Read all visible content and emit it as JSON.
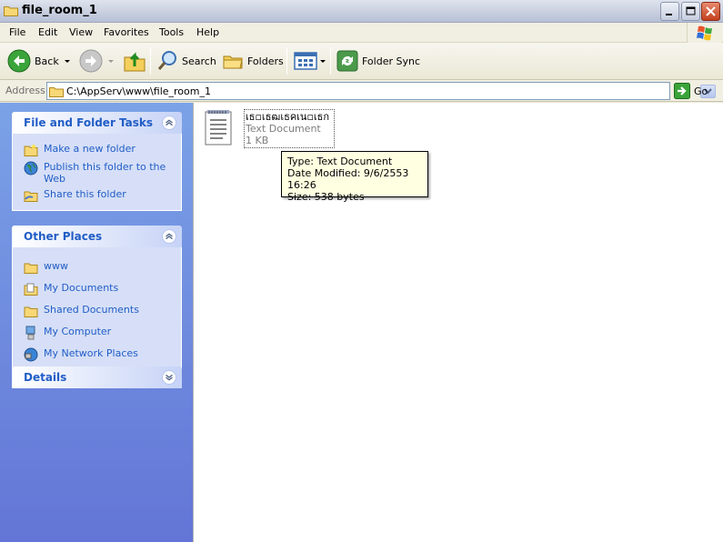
{
  "window": {
    "title": "file_room_1"
  },
  "menu": [
    "File",
    "Edit",
    "View",
    "Favorites",
    "Tools",
    "Help"
  ],
  "toolbar": {
    "back_label": "Back",
    "search_label": "Search",
    "folders_label": "Folders",
    "folder_sync_label": "Folder Sync"
  },
  "address": {
    "label": "Address",
    "value": "C:\\AppServ\\www\\file_room_1",
    "go_label": "Go"
  },
  "panels": {
    "tasks": {
      "title": "File and Folder Tasks",
      "items": [
        "Make a new folder",
        "Publish this folder to the Web",
        "Share this folder"
      ]
    },
    "places": {
      "title": "Other Places",
      "items": [
        "www",
        "My Documents",
        "Shared Documents",
        "My Computer",
        "My Network Places"
      ]
    },
    "details": {
      "title": "Details"
    }
  },
  "file": {
    "name": "เธ▫เธฒเธคเน▫เธก",
    "type": "Text Document",
    "size": "1 KB"
  },
  "tooltip": {
    "type": "Type: Text Document",
    "modified": "Date Modified: 9/6/2553 16:26",
    "size": "Size: 538 bytes"
  },
  "colors": {
    "panel_title": "#215dc6",
    "pane_bg": "#6f8fe0",
    "tooltip_bg": "#ffffe1"
  }
}
